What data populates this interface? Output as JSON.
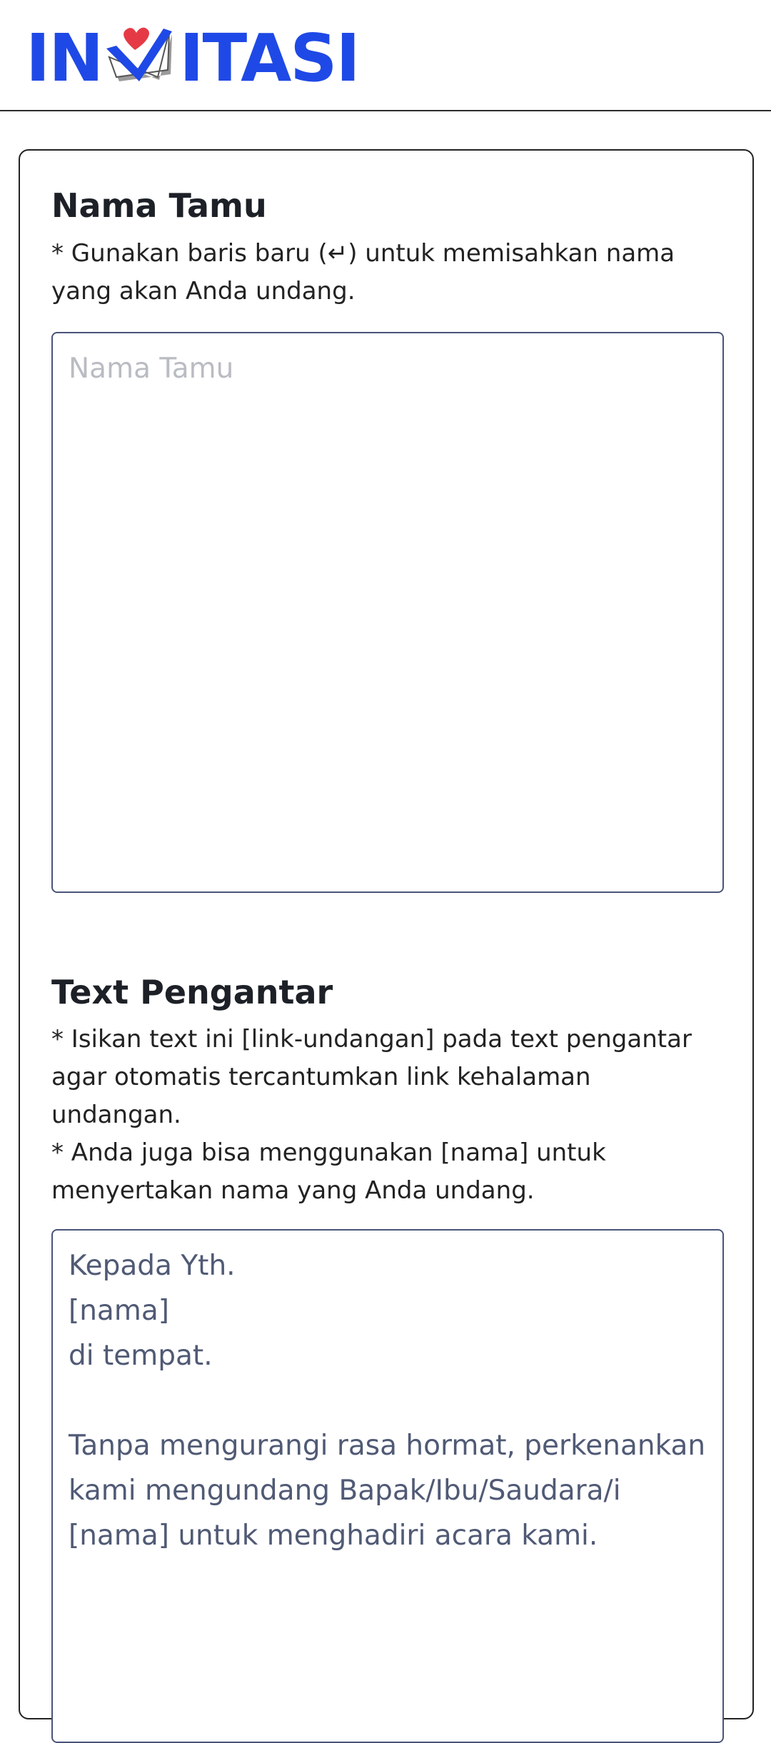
{
  "header": {
    "logo_left": "IN",
    "logo_right": "ITASI",
    "logo_icon": "heart-envelope-icon"
  },
  "guest_section": {
    "title": "Nama Tamu",
    "hint": "* Gunakan baris baru (↵) untuk memisahkan nama yang akan Anda undang.",
    "placeholder": "Nama Tamu",
    "value": ""
  },
  "intro_section": {
    "title": "Text Pengantar",
    "hint_1": "* Isikan text ini [link-undangan] pada text pengantar agar otomatis tercantumkan link kehalaman undangan.",
    "hint_2": "* Anda juga bisa menggunakan [nama] untuk menyertakan nama yang Anda undang.",
    "value": "Kepada Yth.\n[nama]\ndi tempat.\n\nTanpa mengurangi rasa hormat, perkenankan kami mengundang Bapak/Ibu/Saudara/i [nama] untuk menghadiri acara kami.\n"
  },
  "colors": {
    "brand_blue": "#1f49e6",
    "heart_red": "#e53a45",
    "textarea_border": "#4a5478",
    "textarea_text": "#505a75"
  }
}
